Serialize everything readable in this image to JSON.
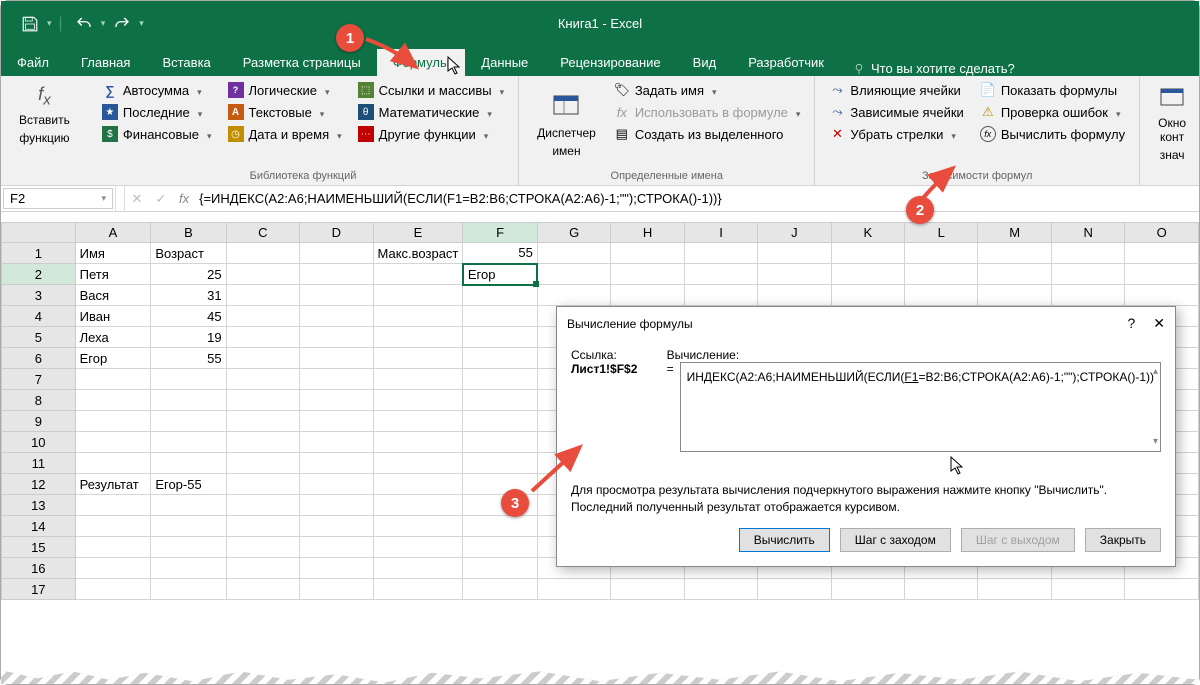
{
  "window": {
    "title": "Книга1  -  Excel"
  },
  "qat": {
    "save": "save",
    "undo": "undo",
    "redo": "redo"
  },
  "tabs": {
    "file": "Файл",
    "home": "Главная",
    "insert": "Вставка",
    "layout": "Разметка страницы",
    "formulas": "Формулы",
    "data": "Данные",
    "review": "Рецензирование",
    "view": "Вид",
    "developer": "Разработчик",
    "tellme": "Что вы хотите сделать?"
  },
  "ribbon": {
    "insert_fn_line1": "Вставить",
    "insert_fn_line2": "функцию",
    "lib": {
      "autosum": "Автосумма",
      "recent": "Последние",
      "financial": "Финансовые",
      "logical": "Логические",
      "text": "Текстовые",
      "datetime": "Дата и время",
      "lookup": "Ссылки и массивы",
      "math": "Математические",
      "more": "Другие функции",
      "group": "Библиотека функций"
    },
    "names": {
      "mgr_line1": "Диспетчер",
      "mgr_line2": "имен",
      "define": "Задать имя",
      "use": "Использовать в формуле",
      "create": "Создать из выделенного",
      "group": "Определенные имена"
    },
    "audit": {
      "precedent": "Влияющие ячейки",
      "dependent": "Зависимые ячейки",
      "remove": "Убрать стрелки",
      "show": "Показать формулы",
      "check": "Проверка ошибок",
      "eval": "Вычислить формулу",
      "group": "Зависимости формул"
    },
    "watch_line1": "Окно конт",
    "watch_line2": "знач"
  },
  "formula_bar": {
    "cell": "F2",
    "fx": "fx",
    "formula": "{=ИНДЕКС(A2:A6;НАИМЕНЬШИЙ(ЕСЛИ(F1=B2:B6;СТРОКА(A2:A6)-1;\"\");СТРОКА()-1))}"
  },
  "columns": [
    "A",
    "B",
    "C",
    "D",
    "E",
    "F",
    "G",
    "H",
    "I",
    "J",
    "K",
    "L",
    "M",
    "N",
    "O"
  ],
  "rows": [
    1,
    2,
    3,
    4,
    5,
    6,
    7,
    8,
    9,
    10,
    11,
    12,
    13,
    14,
    15,
    16,
    17
  ],
  "cells": {
    "A1": "Имя",
    "B1": "Возраст",
    "E1": "Макс.возраст",
    "F1": "55",
    "A2": "Петя",
    "B2": "25",
    "F2": "Егор",
    "A3": "Вася",
    "B3": "31",
    "A4": "Иван",
    "B4": "45",
    "A5": "Леха",
    "B5": "19",
    "A6": "Егор",
    "B6": "55",
    "A12": "Результат",
    "B12": "Егор-55"
  },
  "dialog": {
    "title": "Вычисление формулы",
    "ref_lbl": "Ссылка:",
    "ref_val": "Лист1!$F$2",
    "eval_lbl": "Вычисление:",
    "eq": "=",
    "eval_text_1": "ИНДЕКС(A2:A6;НАИМЕНЬШИЙ(ЕСЛИ(",
    "eval_u": "F1",
    "eval_text_2": "=B2:B6;СТРОКА(A2:A6)-1;\"\");СТРОКА()-1))",
    "help": "Для просмотра результата вычисления подчеркнутого выражения нажмите кнопку \"Вычислить\".  Последний полученный результат отображается курсивом.",
    "btn_eval": "Вычислить",
    "btn_stepin": "Шаг с заходом",
    "btn_stepout": "Шаг с выходом",
    "btn_close": "Закрыть"
  },
  "callouts": {
    "c1": "1",
    "c2": "2",
    "c3": "3"
  }
}
